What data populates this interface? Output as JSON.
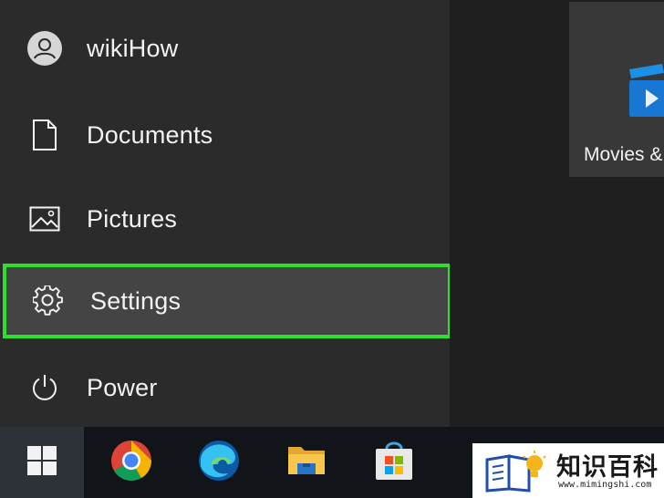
{
  "start_menu": {
    "items": [
      {
        "label": "wikiHow",
        "icon": "user-avatar-icon"
      },
      {
        "label": "Documents",
        "icon": "document-icon"
      },
      {
        "label": "Pictures",
        "icon": "picture-icon"
      },
      {
        "label": "Settings",
        "icon": "gear-icon",
        "selected": true
      },
      {
        "label": "Power",
        "icon": "power-icon"
      }
    ],
    "highlight_color": "#2de02d"
  },
  "tiles": [
    {
      "label": "Movies &",
      "icon": "movies-icon"
    }
  ],
  "taskbar": {
    "buttons": [
      "windows-start-icon",
      "chrome-icon",
      "edge-icon",
      "file-explorer-icon",
      "store-icon"
    ]
  },
  "watermark": {
    "text": "知识百科",
    "url": "www.mimingshi.com"
  }
}
